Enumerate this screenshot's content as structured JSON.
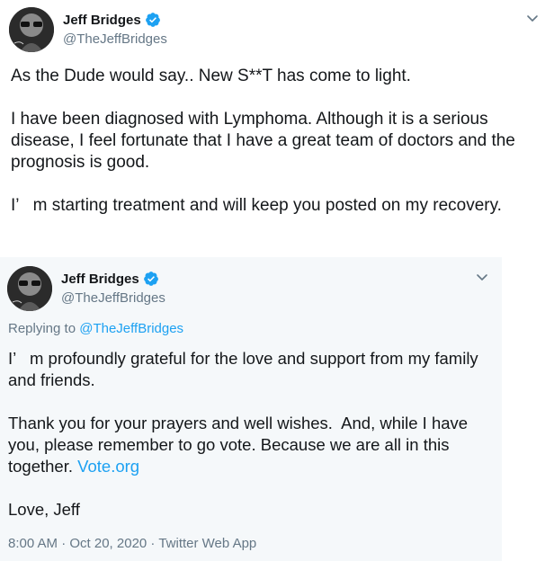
{
  "main_tweet": {
    "display_name": "Jeff Bridges",
    "handle": "@TheJeffBridges",
    "verified": true,
    "body": "As the Dude would say.. New S**T has come to light.\n\nI have been diagnosed with Lymphoma. Although it is a serious disease, I feel fortunate that I have a great team of doctors and the prognosis is good.\n\nI’   m starting treatment and will keep you posted on my recovery."
  },
  "reply_tweet": {
    "display_name": "Jeff Bridges",
    "handle": "@TheJeffBridges",
    "verified": true,
    "replying_prefix": "Replying to ",
    "replying_handle": "@TheJeffBridges",
    "body_before_link": "I’   m profoundly grateful for the love and support from my family and friends.\n\nThank you for your prayers and well wishes.  And, while I have you, please remember to go vote. Because we are all in this together. ",
    "link_text": "Vote.org",
    "body_after_link": "\n\nLove, Jeff",
    "timestamp": "8:00 AM · Oct 20, 2020",
    "separator": " · ",
    "source": "Twitter Web App"
  },
  "colors": {
    "accent": "#1da1f2",
    "secondary_text": "#657786",
    "reply_background": "#f5f8fa"
  },
  "icons": {
    "verified": "verified-badge-icon",
    "menu": "chevron-down-icon"
  }
}
